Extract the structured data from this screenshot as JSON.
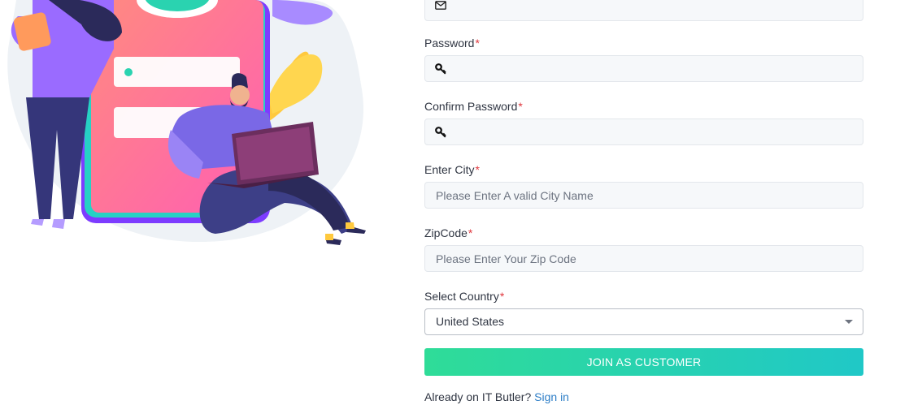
{
  "form": {
    "email": {
      "icon": "mail-icon",
      "value": ""
    },
    "password": {
      "label": "Password",
      "required_mark": "*",
      "icon": "key-icon",
      "value": ""
    },
    "confirm_password": {
      "label": "Confirm Password",
      "required_mark": "*",
      "icon": "key-icon",
      "value": ""
    },
    "city": {
      "label": "Enter City",
      "required_mark": "*",
      "placeholder": "Please Enter A valid City Name"
    },
    "zipcode": {
      "label": "ZipCode",
      "required_mark": "*",
      "placeholder": "Please Enter Your Zip Code"
    },
    "country": {
      "label": "Select Country",
      "required_mark": "*",
      "selected": "United States"
    },
    "submit_label": "JOIN AS CUSTOMER",
    "signin_prompt": "Already on IT Butler?",
    "signin_link": "Sign in"
  },
  "colors": {
    "required": "#e0383e",
    "button_start": "#2fdc98",
    "button_end": "#20c8c7",
    "link": "#2f7fc7"
  }
}
